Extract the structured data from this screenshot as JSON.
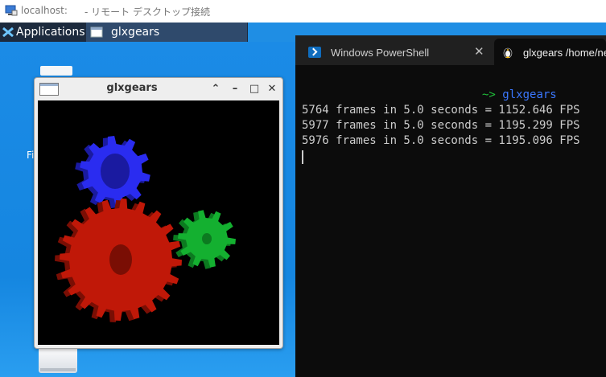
{
  "rdp": {
    "host": "localhost:",
    "title": "- リモート デスクトップ接続"
  },
  "panel": {
    "applications_label": "Applications",
    "task_label": "glxgears"
  },
  "desktop": {
    "icon_label": "Fi"
  },
  "glx_window": {
    "title": "glxgears",
    "shade_glyph": "⌃",
    "min_glyph": "–",
    "max_glyph": "□",
    "close_glyph": "✕"
  },
  "terminal": {
    "tabs": [
      {
        "label": "Windows PowerShell",
        "close_glyph": "✕"
      },
      {
        "label": "glxgears /home/ne"
      }
    ],
    "prompt": "~>",
    "command": "glxgears",
    "lines": [
      "5764 frames in 5.0 seconds = 1152.646 FPS",
      "5977 frames in 5.0 seconds = 1195.299 FPS",
      "5976 frames in 5.0 seconds = 1195.096 FPS"
    ]
  },
  "colors": {
    "gear_red": "#c01808",
    "gear_green": "#14b030",
    "gear_blue": "#2a2cf0",
    "prompt_green": "#1fbf3a",
    "command_blue": "#3b78ff"
  }
}
